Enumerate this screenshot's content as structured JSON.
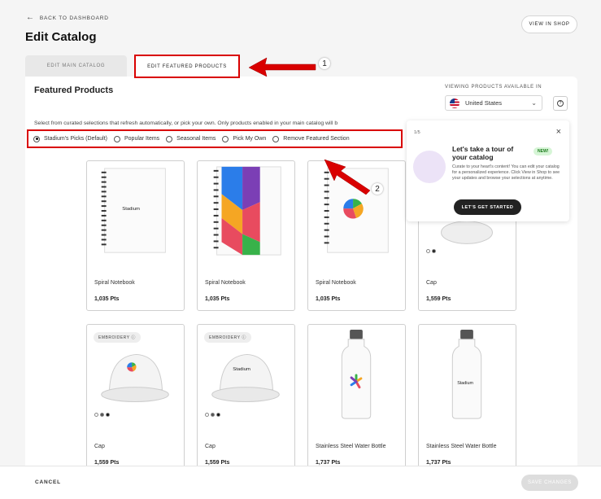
{
  "header": {
    "back_label": "BACK TO DASHBOARD",
    "title": "Edit Catalog",
    "view_in_shop": "VIEW IN SHOP"
  },
  "tabs": {
    "main": "EDIT MAIN CATALOG",
    "featured": "EDIT FEATURED PRODUCTS"
  },
  "featured": {
    "title": "Featured Products",
    "viewing_label": "VIEWING PRODUCTS AVAILABLE IN",
    "country": "United States",
    "description": "Select from curated selections that refresh automatically, or pick your own. Only products enabled in your main catalog will b",
    "options": [
      {
        "label": "Stadium's Picks (Default)",
        "selected": true
      },
      {
        "label": "Popular Items",
        "selected": false
      },
      {
        "label": "Seasonal Items",
        "selected": false
      },
      {
        "label": "Pick My Own",
        "selected": false
      },
      {
        "label": "Remove Featured Section",
        "selected": false
      }
    ]
  },
  "products": [
    {
      "name": "Spiral Notebook",
      "price": "1,035 Pts"
    },
    {
      "name": "Spiral Notebook",
      "price": "1,035 Pts"
    },
    {
      "name": "Spiral Notebook",
      "price": "1,035 Pts"
    },
    {
      "name": "Cap",
      "price": "1,559 Pts"
    },
    {
      "name": "Cap",
      "price": "1,559 Pts",
      "badge": "EMBROIDERY ⓘ"
    },
    {
      "name": "Cap",
      "price": "1,559 Pts",
      "badge": "EMBROIDERY ⓘ"
    },
    {
      "name": "Stainless Steel Water Bottle",
      "price": "1,737 Pts"
    },
    {
      "name": "Stainless Steel Water Bottle",
      "price": "1,737 Pts"
    }
  ],
  "product_brand": "Stadium",
  "tour": {
    "step": "1/5",
    "title": "Let's take a tour of your catalog",
    "new_badge": "NEW!",
    "body": "Curate to your heart's content! You can edit your catalog for a personalized experience. Click View in Shop to see your updates and browse your selections at anytime.",
    "button": "LET'S GET STARTED"
  },
  "footer": {
    "cancel": "CANCEL",
    "save": "SAVE CHANGES"
  },
  "annotations": {
    "callout_1": "1",
    "callout_2": "2"
  },
  "colors": {
    "highlight": "#d90000",
    "dark_button": "#222222"
  }
}
